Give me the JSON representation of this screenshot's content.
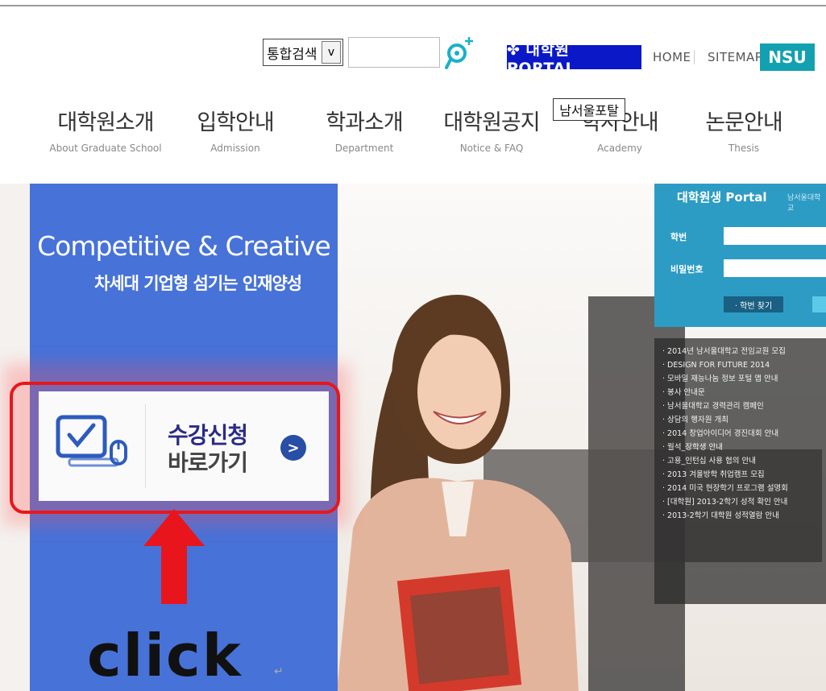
{
  "search": {
    "select_value": "통합검색",
    "select_arrow": "v",
    "input_value": "",
    "icon": "search-icon"
  },
  "utility": {
    "portal_label": "✤ 대학원 PORTAL",
    "home_label": "HOME",
    "sitemap_label": "SITEMAP",
    "nsu_label": "NSU"
  },
  "menu": [
    {
      "ko": "대학원소개",
      "en": "About Graduate School"
    },
    {
      "ko": "입학안내",
      "en": "Admission"
    },
    {
      "ko": "학과소개",
      "en": "Department"
    },
    {
      "ko": "대학원공지",
      "en": "Notice & FAQ"
    },
    {
      "ko": "학사안내",
      "en": "Academy"
    },
    {
      "ko": "논문안내",
      "en": "Thesis"
    }
  ],
  "tooltip": "남서울포탈",
  "hero": {
    "slogan_en": "Competitive & Creative",
    "slogan_ko": "차세대 기업형 섬기는 인재양성",
    "enroll_line1": "수강신청",
    "enroll_line2": "바로가기",
    "go_icon": ">",
    "click_label": "click",
    "click_mark": "↵"
  },
  "portal": {
    "title": "대학원생 Portal",
    "subtitle": "남서울대학교",
    "id_label": "학번",
    "pw_label": "비밀번호",
    "find_label": "· 학번 찾기"
  },
  "news": [
    "· 2014년 남서울대학교 전임교원 모집",
    "· DESIGN FOR FUTURE 2014",
    "· 모바일 재능나눔 정보 포털 앱 안내",
    "· 봉사 안내문",
    "· 남서울대학교 경력관리 캠페인",
    "· 상담의 행자원 개최",
    "· 2014 창업아이디어 경진대회 안내",
    "· 월석_장학생 안내",
    "· 고용_인턴십 사용 협의 안내",
    "· 2013 겨울방학 취업캠프 모집",
    "· 2014 미국 현장학기 프로그램 설명회",
    "· [대학원] 2013-2학기 성적 확인 안내",
    "· 2013-2학기 대학원 성적열람 안내"
  ],
  "colors": {
    "portal_blue": "#0b18c8",
    "nsu_teal": "#13a1b1",
    "panel_blue": "#4772d8",
    "highlight_red": "#e8161c"
  }
}
